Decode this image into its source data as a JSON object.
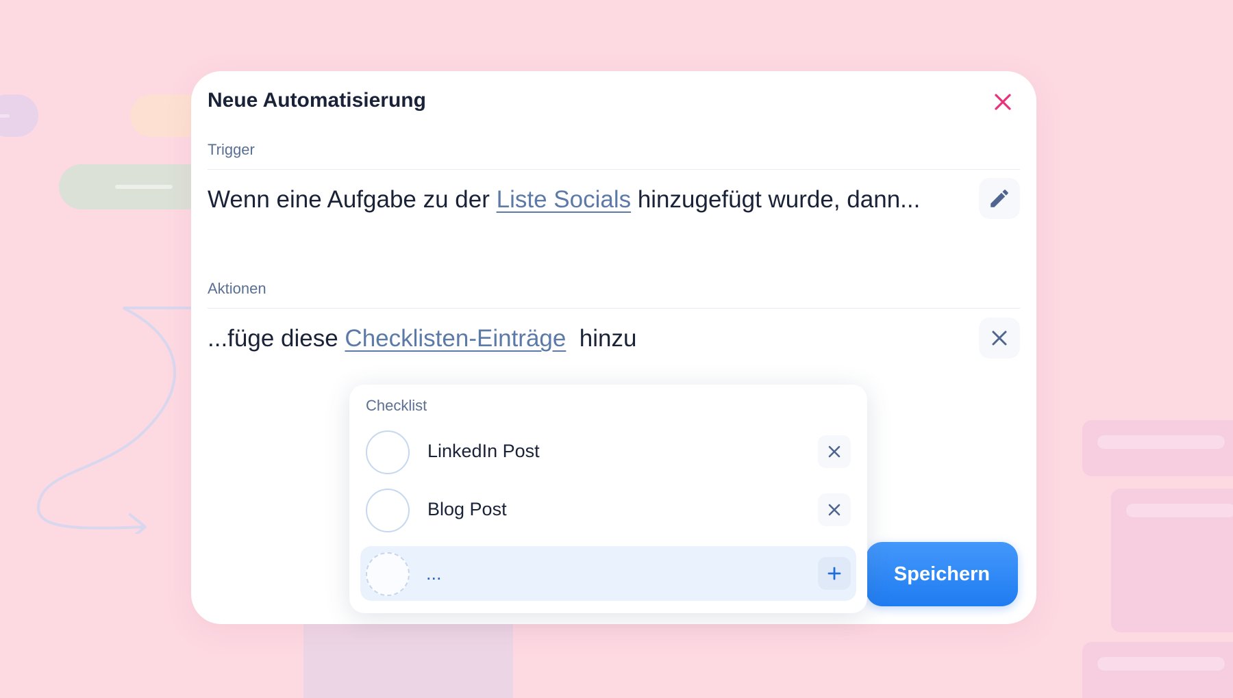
{
  "modal": {
    "title": "Neue Automatisierung",
    "close_icon": "close-icon"
  },
  "trigger": {
    "section_label": "Trigger",
    "text_before": "Wenn eine Aufgabe zu der ",
    "link_text": "Liste Socials",
    "text_after": " hinzugefügt wurde, dann...",
    "edit_icon": "pencil-icon"
  },
  "actions": {
    "section_label": "Aktionen",
    "text_before": "...füge diese ",
    "link_text": "Checklisten-Einträge",
    "text_after": "  hinzu",
    "remove_icon": "close-icon"
  },
  "checklist": {
    "label": "Checklist",
    "items": [
      {
        "label": "LinkedIn Post",
        "remove_icon": "close-icon"
      },
      {
        "label": "Blog Post",
        "remove_icon": "close-icon"
      }
    ],
    "new_item": {
      "value": "...",
      "add_icon": "plus-icon"
    }
  },
  "save_button": {
    "label": "Speichern"
  },
  "colors": {
    "background": "#fdd9e2",
    "accent": "#1f7cf1",
    "close": "#e8337a",
    "link": "#5c7aa8",
    "text": "#1a2238"
  }
}
